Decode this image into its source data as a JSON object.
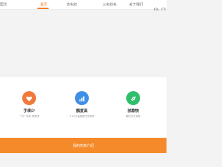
{
  "header": {
    "brand": "国沃",
    "nav": [
      {
        "label": "首页",
        "active": true
      },
      {
        "label": "省实效",
        "active": false
      },
      {
        "label": "三实效名",
        "active": false
      },
      {
        "label": "关于我们",
        "active": false
      }
    ],
    "icons": [
      "wechat-icon",
      "account-icon"
    ]
  },
  "features": [
    {
      "title": "手续少",
      "desc": "一份一保安 简便快",
      "color": "#f07a3c",
      "icon": "heart-icon"
    },
    {
      "title": "额度高",
      "desc": "1-10万高额度任您借用",
      "color": "#3f8fe6",
      "icon": "bar-chart-icon"
    },
    {
      "title": "放款快",
      "desc": "最快当天到账",
      "color": "#2fbf6b",
      "icon": "leaf-icon"
    }
  ],
  "cta": {
    "label": "我的实效介绍"
  },
  "colors": {
    "accent": "#f47b20",
    "cta_bg": "#f58a2a"
  }
}
